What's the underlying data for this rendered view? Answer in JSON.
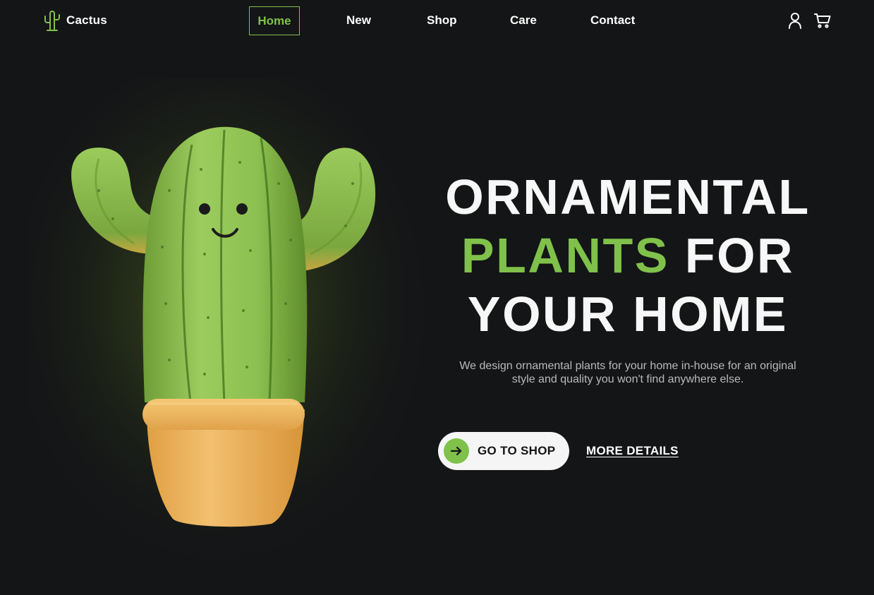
{
  "brand": {
    "name": "Cactus",
    "logo_icon": "cactus-icon",
    "accent_color": "#7fc14a"
  },
  "nav": {
    "items": [
      {
        "label": "Home",
        "active": true
      },
      {
        "label": "New",
        "active": false
      },
      {
        "label": "Shop",
        "active": false
      },
      {
        "label": "Care",
        "active": false
      },
      {
        "label": "Contact",
        "active": false
      }
    ]
  },
  "header_actions": {
    "user_icon": "user-icon",
    "cart_icon": "cart-icon"
  },
  "hero": {
    "image_subject": "cactus-in-pot-illustration",
    "headline_line1": "ORNAMENTAL",
    "headline_accent": "PLANTS",
    "headline_line2_rest": " FOR",
    "headline_line3": "YOUR HOME",
    "subtitle": "We design ornamental plants for your home in-house for an original style and quality you won't find anywhere else.",
    "primary_cta": "GO TO SHOP",
    "primary_cta_icon": "arrow-right-icon",
    "secondary_cta": "MORE DETAILS"
  },
  "colors": {
    "background": "#141517",
    "accent": "#7fc14a",
    "text": "#ffffff",
    "muted_text": "#b8b9bb",
    "button_bg": "#f5f5f5"
  }
}
